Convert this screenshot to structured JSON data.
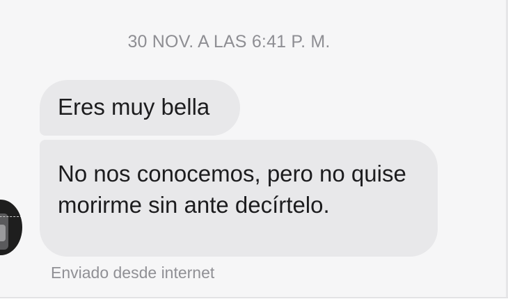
{
  "chat": {
    "timestamp": "30 NOV. A LAS 6:41 P. M.",
    "messages": [
      {
        "text": "Eres muy bella"
      },
      {
        "text": "No nos conocemos, pero no quise morirme sin ante decírtelo."
      }
    ],
    "footer_note": "Enviado desde internet"
  },
  "colors": {
    "background": "#f6f6f7",
    "bubble": "#e8e8ea",
    "text": "#1c1c1e",
    "meta_text": "#8e8e93"
  }
}
